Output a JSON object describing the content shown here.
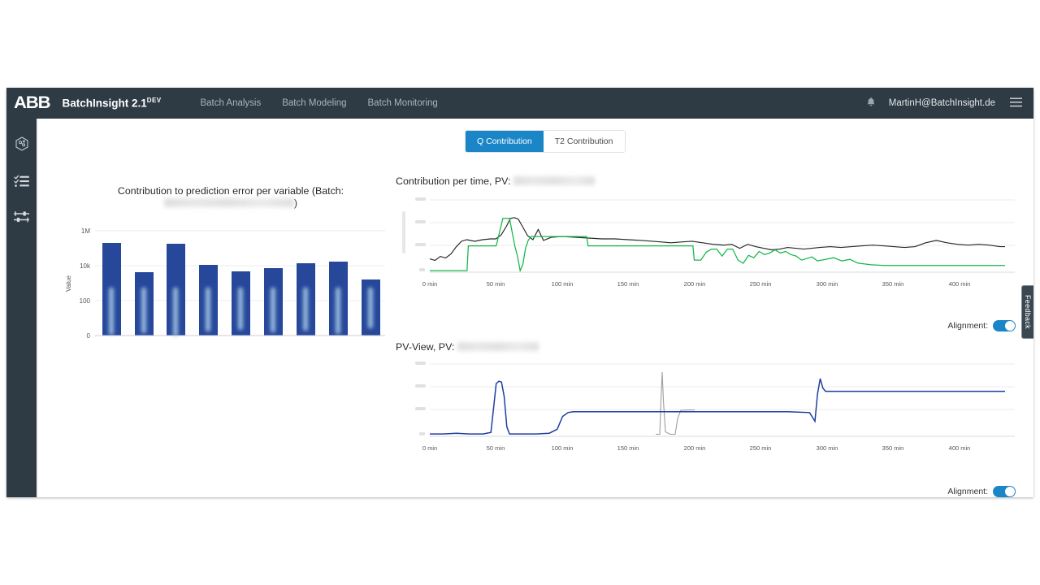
{
  "header": {
    "logo": "ABB",
    "app_title": "BatchInsight 2.1",
    "app_title_sup": "DEV",
    "nav": [
      {
        "label": "Batch Analysis"
      },
      {
        "label": "Batch Modeling"
      },
      {
        "label": "Batch Monitoring"
      }
    ],
    "bell_icon": "bell-icon",
    "user_email": "MartinH@BatchInsight.de",
    "menu_icon": "hamburger-icon"
  },
  "sidebar": {
    "items": [
      {
        "icon": "molecule-icon",
        "name": "batch-model"
      },
      {
        "icon": "checklist-icon",
        "name": "batch-list"
      },
      {
        "icon": "sliders-icon",
        "name": "batch-settings"
      }
    ]
  },
  "tabs": [
    {
      "label": "Q Contribution",
      "active": true
    },
    {
      "label": "T2 Contribution",
      "active": false
    }
  ],
  "panels": {
    "bar": {
      "title_prefix": "Contribution to prediction error per variable (Batch:",
      "title_suffix": ")",
      "batch_name": "",
      "batch_name_redacted": true
    },
    "contribution": {
      "title_prefix": "Contribution per time, PV:",
      "pv_name": "",
      "pv_name_redacted": true,
      "alignment_label": "Alignment:",
      "alignment_on": true
    },
    "pvview": {
      "title_prefix": "PV-View, PV:",
      "pv_name": "",
      "pv_name_redacted": true,
      "alignment_label": "Alignment:",
      "alignment_on": true
    }
  },
  "feedback": {
    "label": "Feedback"
  },
  "colors": {
    "accent": "#1a86c8",
    "topbar": "#2e3b45",
    "bar_fill": "#27479b",
    "line_dark": "#262626",
    "line_green": "#12b84a",
    "line_blue": "#1f3fa0",
    "line_gray": "#9e9e9e"
  },
  "chart_data": [
    {
      "type": "bar",
      "name": "contribution-per-variable",
      "title": "Contribution to prediction error per variable (Batch: [redacted])",
      "xlabel": "",
      "ylabel": "Value",
      "yscale": "log",
      "yticks": [
        "0",
        "100",
        "10k",
        "1M"
      ],
      "ytick_values": [
        0,
        100,
        10000,
        1000000
      ],
      "ylim": [
        0,
        1000000
      ],
      "grid": true,
      "categories": [
        "",
        "",
        "",
        "",
        "",
        "",
        "",
        "",
        ""
      ],
      "categories_redacted": true,
      "values": [
        95000,
        1300,
        92000,
        4200,
        2400,
        3300,
        5000,
        5600,
        700
      ]
    },
    {
      "type": "line",
      "name": "contribution-per-time",
      "title": "Contribution per time, PV: [redacted]",
      "xlabel": "",
      "ylabel": "",
      "xticks": [
        "0 min",
        "50 min",
        "100 min",
        "150 min",
        "200 min",
        "250 min",
        "300 min",
        "350 min",
        "400 min"
      ],
      "xtick_values": [
        0,
        50,
        100,
        150,
        200,
        250,
        300,
        350,
        400
      ],
      "xlim": [
        0,
        440
      ],
      "yticks_redacted": true,
      "ytick_count": 4,
      "grid": true,
      "legend": "none",
      "series": [
        {
          "name": "contribution-dark",
          "color": "#262626",
          "x": [
            0,
            4,
            8,
            12,
            16,
            20,
            24,
            28,
            34,
            40,
            46,
            50,
            54,
            58,
            61,
            64,
            67,
            70,
            74,
            78,
            82,
            86,
            92,
            100,
            110,
            120,
            130,
            140,
            150,
            160,
            168,
            175,
            182,
            190,
            198,
            206,
            214,
            222,
            228,
            234,
            240,
            246,
            252,
            258,
            264,
            270,
            276,
            282,
            288,
            294,
            300,
            308,
            316,
            324,
            332,
            340,
            348,
            356,
            364,
            372,
            380,
            388,
            396,
            404,
            412,
            420,
            428,
            436,
            440
          ],
          "y": [
            0.18,
            0.16,
            0.21,
            0.19,
            0.24,
            0.33,
            0.4,
            0.42,
            0.41,
            0.43,
            0.44,
            0.44,
            0.49,
            0.6,
            0.7,
            0.71,
            0.69,
            0.6,
            0.48,
            0.42,
            0.55,
            0.41,
            0.45,
            0.46,
            0.45,
            0.44,
            0.43,
            0.43,
            0.42,
            0.42,
            0.41,
            0.4,
            0.39,
            0.4,
            0.41,
            0.39,
            0.37,
            0.36,
            0.38,
            0.37,
            0.44,
            0.37,
            0.35,
            0.33,
            0.32,
            0.33,
            0.34,
            0.36,
            0.35,
            0.34,
            0.35,
            0.36,
            0.35,
            0.36,
            0.37,
            0.36,
            0.35,
            0.34,
            0.34,
            0.35,
            0.38,
            0.41,
            0.38,
            0.36,
            0.35,
            0.36,
            0.35,
            0.33,
            0.33
          ]
        },
        {
          "name": "contribution-green",
          "color": "#12b84a",
          "x": [
            0,
            10,
            20,
            28,
            29,
            36,
            44,
            50,
            55,
            56,
            60,
            64,
            66,
            68,
            70,
            72,
            74,
            76,
            78,
            80,
            84,
            90,
            100,
            112,
            118,
            119,
            126,
            134,
            142,
            150,
            160,
            170,
            180,
            190,
            198,
            199,
            204,
            208,
            212,
            216,
            220,
            224,
            228,
            232,
            236,
            240,
            244,
            248,
            252,
            256,
            260,
            264,
            268,
            272,
            276,
            280,
            284,
            288,
            292,
            296,
            300,
            306,
            312,
            318,
            324,
            330,
            340,
            350,
            360,
            380,
            400,
            420,
            440
          ],
          "y": [
            0.02,
            0.02,
            0.02,
            0.02,
            0.33,
            0.33,
            0.33,
            0.33,
            0.68,
            0.68,
            0.68,
            0.33,
            0.2,
            0.02,
            0.1,
            0.3,
            0.4,
            0.42,
            0.42,
            0.42,
            0.42,
            0.42,
            0.42,
            0.42,
            0.42,
            0.3,
            0.3,
            0.3,
            0.3,
            0.3,
            0.3,
            0.3,
            0.3,
            0.3,
            0.3,
            0.12,
            0.12,
            0.22,
            0.26,
            0.26,
            0.17,
            0.26,
            0.26,
            0.12,
            0.08,
            0.18,
            0.14,
            0.22,
            0.18,
            0.2,
            0.24,
            0.22,
            0.26,
            0.22,
            0.24,
            0.2,
            0.18,
            0.12,
            0.14,
            0.16,
            0.1,
            0.12,
            0.14,
            0.1,
            0.12,
            0.07,
            0.05,
            0.04,
            0.04,
            0.04,
            0.04,
            0.04,
            0.04
          ]
        }
      ]
    },
    {
      "type": "line",
      "name": "pv-view",
      "title": "PV-View, PV: [redacted]",
      "xlabel": "",
      "ylabel": "",
      "xticks": [
        "0 min",
        "50 min",
        "100 min",
        "150 min",
        "200 min",
        "250 min",
        "300 min",
        "350 min",
        "400 min"
      ],
      "xtick_values": [
        0,
        50,
        100,
        150,
        200,
        250,
        300,
        350,
        400
      ],
      "xlim": [
        0,
        440
      ],
      "yticks_redacted": true,
      "ytick_count": 4,
      "grid": true,
      "legend": "none",
      "series": [
        {
          "name": "pv-blue",
          "color": "#1f3fa0",
          "x": [
            0,
            10,
            20,
            30,
            40,
            46,
            48,
            50,
            52,
            54,
            56,
            58,
            60,
            62,
            70,
            80,
            90,
            96,
            100,
            104,
            108,
            114,
            130,
            150,
            170,
            180,
            190,
            200,
            220,
            240,
            260,
            280,
            296,
            300,
            302,
            304,
            306,
            308,
            312,
            320,
            340,
            360,
            380,
            400,
            420,
            440
          ],
          "y": [
            0.03,
            0.03,
            0.04,
            0.03,
            0.03,
            0.05,
            0.35,
            0.66,
            0.69,
            0.68,
            0.5,
            0.12,
            0.03,
            0.03,
            0.03,
            0.03,
            0.04,
            0.1,
            0.26,
            0.31,
            0.32,
            0.32,
            0.32,
            0.32,
            0.32,
            0.32,
            0.32,
            0.32,
            0.32,
            0.32,
            0.32,
            0.32,
            0.31,
            0.2,
            0.55,
            0.74,
            0.62,
            0.58,
            0.58,
            0.58,
            0.58,
            0.58,
            0.58,
            0.58,
            0.58,
            0.58
          ]
        },
        {
          "name": "pv-gray-spike",
          "color": "#9e9e9e",
          "x": [
            170,
            173,
            174,
            175,
            176,
            178,
            182,
            186,
            188,
            190,
            196,
            200
          ],
          "y": [
            0.03,
            0.03,
            0.55,
            0.8,
            0.55,
            0.06,
            0.03,
            0.03,
            0.22,
            0.31,
            0.32,
            0.32
          ]
        }
      ]
    }
  ]
}
